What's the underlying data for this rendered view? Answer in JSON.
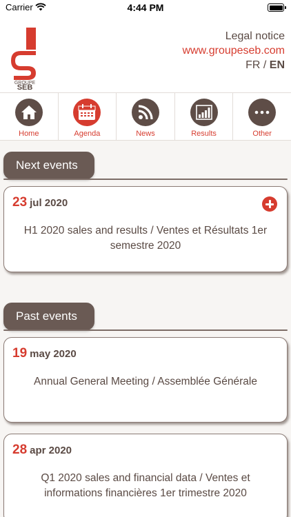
{
  "status_bar": {
    "carrier": "Carrier",
    "time": "4:44 PM"
  },
  "header": {
    "logo_text": "GROUPE SEB",
    "legal_notice": "Legal notice",
    "website": "www.groupeseb.com",
    "lang_fr": "FR",
    "lang_sep": "/",
    "lang_en": "EN"
  },
  "nav": {
    "items": [
      {
        "label": "Home",
        "icon": "home-icon"
      },
      {
        "label": "Agenda",
        "icon": "calendar-icon"
      },
      {
        "label": "News",
        "icon": "rss-icon"
      },
      {
        "label": "Results",
        "icon": "bar-chart-icon"
      },
      {
        "label": "Other",
        "icon": "more-icon"
      }
    ]
  },
  "sections": {
    "next": {
      "title": "Next events"
    },
    "past": {
      "title": "Past events"
    }
  },
  "events": {
    "next": [
      {
        "day": "23",
        "month_year": "jul 2020",
        "title": "H1 2020 sales and results / Ventes et Résultats 1er semestre 2020"
      }
    ],
    "past": [
      {
        "day": "19",
        "month_year": "may 2020",
        "title": "Annual General Meeting / Assemblée Générale"
      },
      {
        "day": "28",
        "month_year": "apr 2020",
        "title": "Q1 2020 sales and financial data / Ventes et informations financières 1er trimestre 2020"
      }
    ]
  },
  "colors": {
    "accent": "#d63c2f",
    "brown": "#5a4a44",
    "tab_bg": "#6a5a54",
    "background": "#f7f5f3"
  }
}
